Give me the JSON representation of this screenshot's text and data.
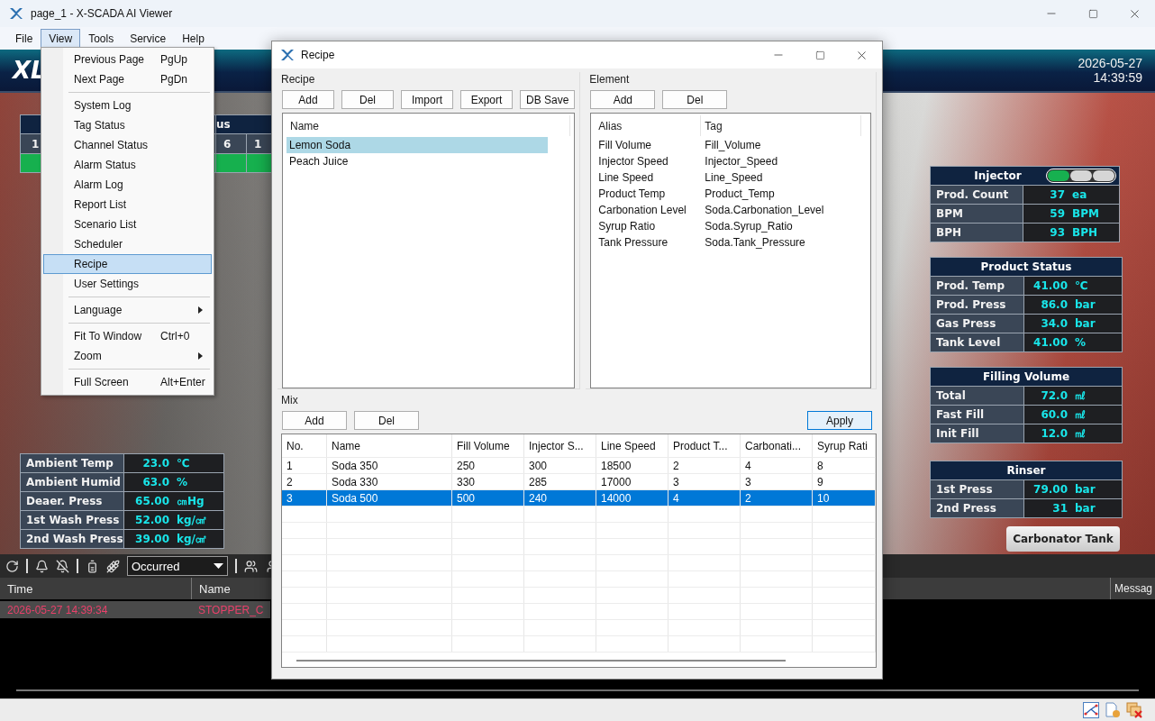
{
  "window": {
    "title": "page_1 - X-SCADA AI Viewer"
  },
  "menubar": [
    {
      "label": "File",
      "selected": false
    },
    {
      "label": "View",
      "selected": true
    },
    {
      "label": "Tools",
      "selected": false
    },
    {
      "label": "Service",
      "selected": false
    },
    {
      "label": "Help",
      "selected": false
    }
  ],
  "view_menu": [
    {
      "kind": "item",
      "label": "Previous Page",
      "shortcut": "PgUp",
      "selected": false,
      "has_submenu": false
    },
    {
      "kind": "item",
      "label": "Next Page",
      "shortcut": "PgDn",
      "selected": false,
      "has_submenu": false
    },
    {
      "kind": "separator"
    },
    {
      "kind": "item",
      "label": "System Log",
      "selected": false,
      "has_submenu": false
    },
    {
      "kind": "item",
      "label": "Tag Status",
      "selected": false,
      "has_submenu": false
    },
    {
      "kind": "item",
      "label": "Channel Status",
      "selected": false,
      "has_submenu": false
    },
    {
      "kind": "item",
      "label": "Alarm Status",
      "selected": false,
      "has_submenu": false
    },
    {
      "kind": "item",
      "label": "Alarm Log",
      "selected": false,
      "has_submenu": false
    },
    {
      "kind": "item",
      "label": "Report List",
      "selected": false,
      "has_submenu": false
    },
    {
      "kind": "item",
      "label": "Scenario List",
      "selected": false,
      "has_submenu": false
    },
    {
      "kind": "item",
      "label": "Scheduler",
      "selected": false,
      "has_submenu": false
    },
    {
      "kind": "item",
      "label": "Recipe",
      "selected": true,
      "has_submenu": false
    },
    {
      "kind": "item",
      "label": "User Settings",
      "selected": false,
      "has_submenu": false
    },
    {
      "kind": "separator"
    },
    {
      "kind": "item",
      "label": "Language",
      "selected": false,
      "has_submenu": true
    },
    {
      "kind": "separator"
    },
    {
      "kind": "item",
      "label": "Fit To Window",
      "shortcut": "Ctrl+0",
      "selected": false,
      "has_submenu": false
    },
    {
      "kind": "item",
      "label": "Zoom",
      "selected": false,
      "has_submenu": true
    },
    {
      "kind": "separator"
    },
    {
      "kind": "item",
      "label": "Full Screen",
      "shortcut": "Alt+Enter",
      "selected": false,
      "has_submenu": false
    }
  ],
  "banner": {
    "logo": "XL",
    "date": "2026-05-27",
    "time": "14:39:59"
  },
  "status_fragment": {
    "header": "us",
    "cells": [
      "1",
      "6",
      "1"
    ]
  },
  "ambient_panel": [
    {
      "label": "Ambient Temp",
      "value": "23.0",
      "unit": "℃"
    },
    {
      "label": "Ambient Humid",
      "value": "63.0",
      "unit": "%"
    },
    {
      "label": "Deaer. Press",
      "value": "65.00",
      "unit": "㎝Hg"
    },
    {
      "label": "1st Wash Press",
      "value": "52.00",
      "unit": "kg/㎠"
    },
    {
      "label": "2nd Wash Press",
      "value": "39.00",
      "unit": "kg/㎠"
    }
  ],
  "panels": [
    {
      "title": "Injector",
      "lamps": [
        {
          "on": true
        },
        {
          "on": false
        },
        {
          "on": false
        }
      ],
      "rows": [
        {
          "label": "Prod. Count",
          "value": "37",
          "unit": "ea"
        },
        {
          "label": "BPM",
          "value": "59",
          "unit": "BPM"
        },
        {
          "label": "BPH",
          "value": "93",
          "unit": "BPH"
        }
      ]
    },
    {
      "title": "Product Status",
      "rows": [
        {
          "label": "Prod. Temp",
          "value": "41.00",
          "unit": "℃"
        },
        {
          "label": "Prod. Press",
          "value": "86.0",
          "unit": "bar"
        },
        {
          "label": "Gas Press",
          "value": "34.0",
          "unit": "bar"
        },
        {
          "label": "Tank Level",
          "value": "41.00",
          "unit": "%"
        }
      ]
    },
    {
      "title": "Filling Volume",
      "rows": [
        {
          "label": "Total",
          "value": "72.0",
          "unit": "㎖"
        },
        {
          "label": "Fast Fill",
          "value": "60.0",
          "unit": "㎖"
        },
        {
          "label": "Init Fill",
          "value": "12.0",
          "unit": "㎖"
        }
      ]
    },
    {
      "title": "Rinser",
      "rows": [
        {
          "label": "1st Press",
          "value": "79.00",
          "unit": "bar"
        },
        {
          "label": "2nd Press",
          "value": "31",
          "unit": "bar"
        }
      ]
    }
  ],
  "carbonator_button": "Carbonator Tank",
  "alarm": {
    "filter": "Occurred",
    "columns": [
      "Time",
      "Name",
      "Messag"
    ],
    "rows": [
      {
        "time": "2026-05-27 14:39:34",
        "name": "STOPPER_C"
      }
    ]
  },
  "recipe_dialog": {
    "title": "Recipe",
    "recipe": {
      "title": "Recipe",
      "buttons": [
        "Add",
        "Del",
        "Import",
        "Export",
        "DB Save"
      ],
      "column": "Name",
      "items": [
        {
          "label": "Lemon Soda",
          "selected": true
        },
        {
          "label": "Peach Juice",
          "selected": false
        }
      ]
    },
    "element": {
      "title": "Element",
      "buttons": [
        "Add",
        "Del"
      ],
      "columns": [
        "Alias",
        "Tag"
      ],
      "rows": [
        {
          "alias": "Fill Volume",
          "tag": "Fill_Volume"
        },
        {
          "alias": "Injector Speed",
          "tag": "Injector_Speed"
        },
        {
          "alias": "Line Speed",
          "tag": "Line_Speed"
        },
        {
          "alias": "Product Temp",
          "tag": "Product_Temp"
        },
        {
          "alias": "Carbonation Level",
          "tag": "Soda.Carbonation_Level"
        },
        {
          "alias": "Syrup Ratio",
          "tag": "Soda.Syrup_Ratio"
        },
        {
          "alias": "Tank Pressure",
          "tag": "Soda.Tank_Pressure"
        }
      ]
    },
    "mix": {
      "title": "Mix",
      "buttons": [
        "Add",
        "Del"
      ],
      "apply": "Apply",
      "columns": [
        "No.",
        "Name",
        "Fill Volume",
        "Injector S...",
        "Line Speed",
        "Product T...",
        "Carbonati...",
        "Syrup Rati"
      ],
      "rows": [
        {
          "cells": [
            "1",
            "Soda 350",
            "250",
            "300",
            "18500",
            "2",
            "4",
            "8"
          ],
          "selected": false
        },
        {
          "cells": [
            "2",
            "Soda 330",
            "330",
            "285",
            "17000",
            "3",
            "3",
            "9"
          ],
          "selected": false
        },
        {
          "cells": [
            "3",
            "Soda 500",
            "500",
            "240",
            "14000",
            "4",
            "2",
            "10"
          ],
          "selected": true
        }
      ]
    }
  }
}
